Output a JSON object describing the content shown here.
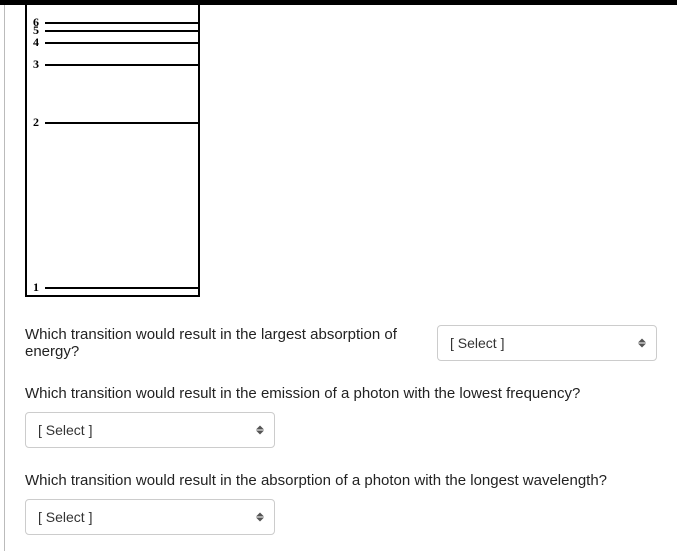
{
  "diagram": {
    "levels": [
      {
        "label": "6",
        "position": 10
      },
      {
        "label": "5",
        "position": 18
      },
      {
        "label": "4",
        "position": 30
      },
      {
        "label": "3",
        "position": 52
      },
      {
        "label": "2",
        "position": 110
      },
      {
        "label": "1",
        "position": 275
      }
    ]
  },
  "questions": {
    "q1": {
      "text": "Which transition would result in the largest absorption of energy?",
      "select_placeholder": "[ Select ]"
    },
    "q2": {
      "text": "Which transition would result in the emission of a photon with the lowest frequency?",
      "select_placeholder": "[ Select ]"
    },
    "q3": {
      "text": "Which transition would result in the absorption of a photon with the longest wavelength?",
      "select_placeholder": "[ Select ]"
    }
  }
}
